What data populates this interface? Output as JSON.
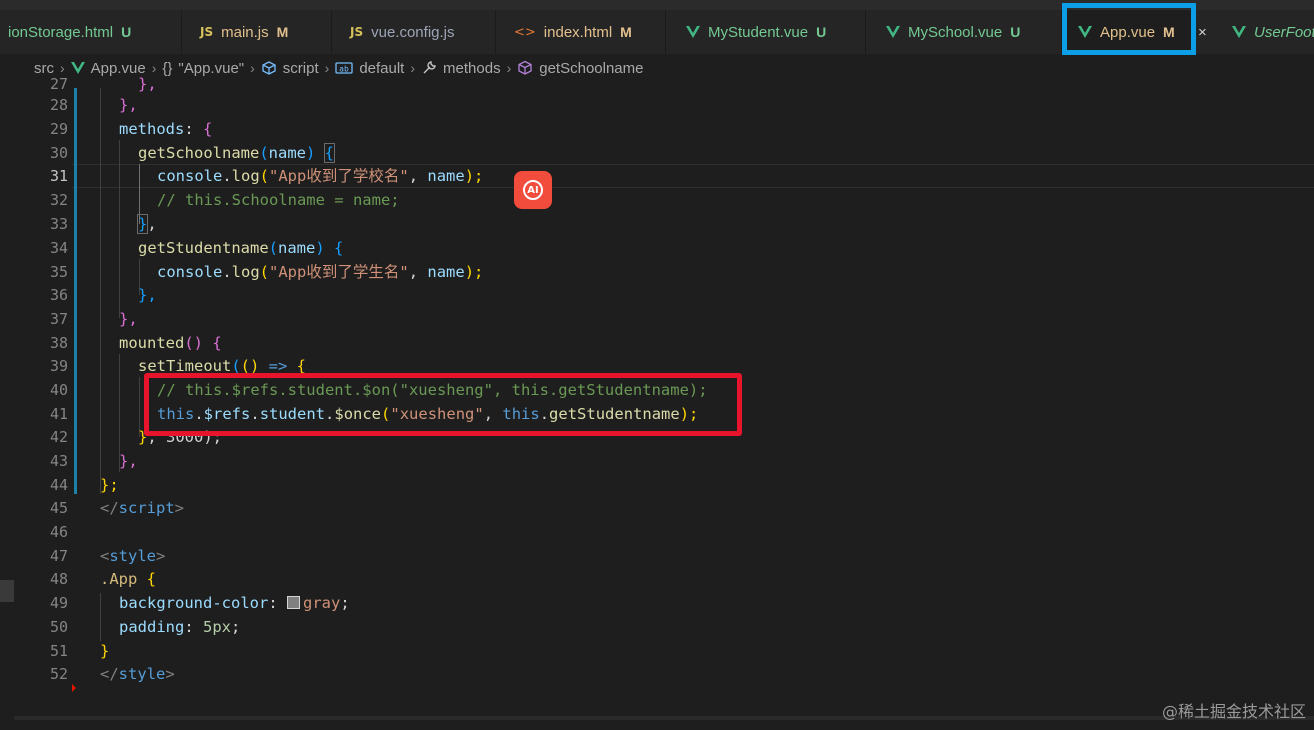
{
  "tabs": [
    {
      "name": "ionStorage.html",
      "status": "U",
      "icon": "none"
    },
    {
      "name": "main.js",
      "status": "M",
      "icon": "JS"
    },
    {
      "name": "vue.config.js",
      "status": "",
      "icon": "JS"
    },
    {
      "name": "index.html",
      "status": "M",
      "icon": "html"
    },
    {
      "name": "MyStudent.vue",
      "status": "U",
      "icon": "vue"
    },
    {
      "name": "MySchool.vue",
      "status": "U",
      "icon": "vue"
    },
    {
      "name": "App.vue",
      "status": "M",
      "icon": "vue",
      "active": true
    },
    {
      "name": "UserFoot",
      "status": "",
      "icon": "vue"
    }
  ],
  "breadcrumb": {
    "src": "src",
    "file": "App.vue",
    "braces": "{}",
    "block": "\"App.vue\"",
    "script": "script",
    "default": "default",
    "methods": "methods",
    "fn": "getSchoolname"
  },
  "line_numbers": [
    "27",
    "28",
    "29",
    "30",
    "31",
    "32",
    "33",
    "34",
    "35",
    "36",
    "37",
    "38",
    "39",
    "40",
    "41",
    "42",
    "43",
    "44",
    "45",
    "46",
    "47",
    "48",
    "49",
    "50",
    "51",
    "52"
  ],
  "current_line": "31",
  "code": {
    "l27": "},",
    "l28": "},",
    "l29_a": "methods",
    "l29_b": ": ",
    "l29_c": "{",
    "l30_fn": "getSchoolname",
    "l30_p1": "(",
    "l30_arg": "name",
    "l30_p2": ") ",
    "l30_b": "{",
    "l31_obj": "console",
    "l31_dot": ".",
    "l31_fn": "log",
    "l31_p1": "(",
    "l31_str": "\"App收到了学校名\"",
    "l31_c": ", ",
    "l31_arg": "name",
    "l31_p2": ");",
    "l32": "// this.Schoolname = name;",
    "l33_b": "}",
    "l33_c": ",",
    "l34_fn": "getStudentname",
    "l34_p1": "(",
    "l34_arg": "name",
    "l34_p2": ") ",
    "l34_b": "{",
    "l35_obj": "console",
    "l35_dot": ".",
    "l35_fn": "log",
    "l35_p1": "(",
    "l35_str": "\"App收到了学生名\"",
    "l35_c": ", ",
    "l35_arg": "name",
    "l35_p2": ");",
    "l36": "},",
    "l37": "},",
    "l38_fn": "mounted",
    "l38_p": "() ",
    "l38_b": "{",
    "l39_fn": "setTimeout",
    "l39_p1": "(",
    "l39_p2": "() ",
    "l39_arrow": "=> ",
    "l39_b": "{",
    "l40": "// this.$refs.student.$on(\"xuesheng\", this.getStudentname);",
    "l41_this": "this",
    "l41_d1": ".",
    "l41_refs": "$refs",
    "l41_d2": ".",
    "l41_stu": "student",
    "l41_d3": ".",
    "l41_once": "$once",
    "l41_p1": "(",
    "l41_str": "\"xuesheng\"",
    "l41_c": ", ",
    "l41_this2": "this",
    "l41_d4": ".",
    "l41_fn": "getStudentname",
    "l41_p2": ");",
    "l42_b": "}",
    "l42_rest": ", 3000);",
    "l43": "},",
    "l44": "};",
    "l45_o": "</",
    "l45_t": "script",
    "l45_c": ">",
    "l47_o": "<",
    "l47_t": "style",
    "l47_c": ">",
    "l48_sel": ".App",
    "l48_b": " {",
    "l49_prop": "background-color",
    "l49_c": ": ",
    "l49_val": "gray",
    "l49_s": ";",
    "l50_prop": "padding",
    "l50_c": ": ",
    "l50_val": "5px",
    "l50_s": ";",
    "l51": "}",
    "l52_o": "</",
    "l52_t": "style",
    "l52_c": ">"
  },
  "ai_button": "AI",
  "watermark": "@稀土掘金技术社区",
  "colors": {
    "highlight_blue": "#0c9ee6",
    "highlight_red": "#e8142b",
    "ai_button": "#f24c3d"
  }
}
